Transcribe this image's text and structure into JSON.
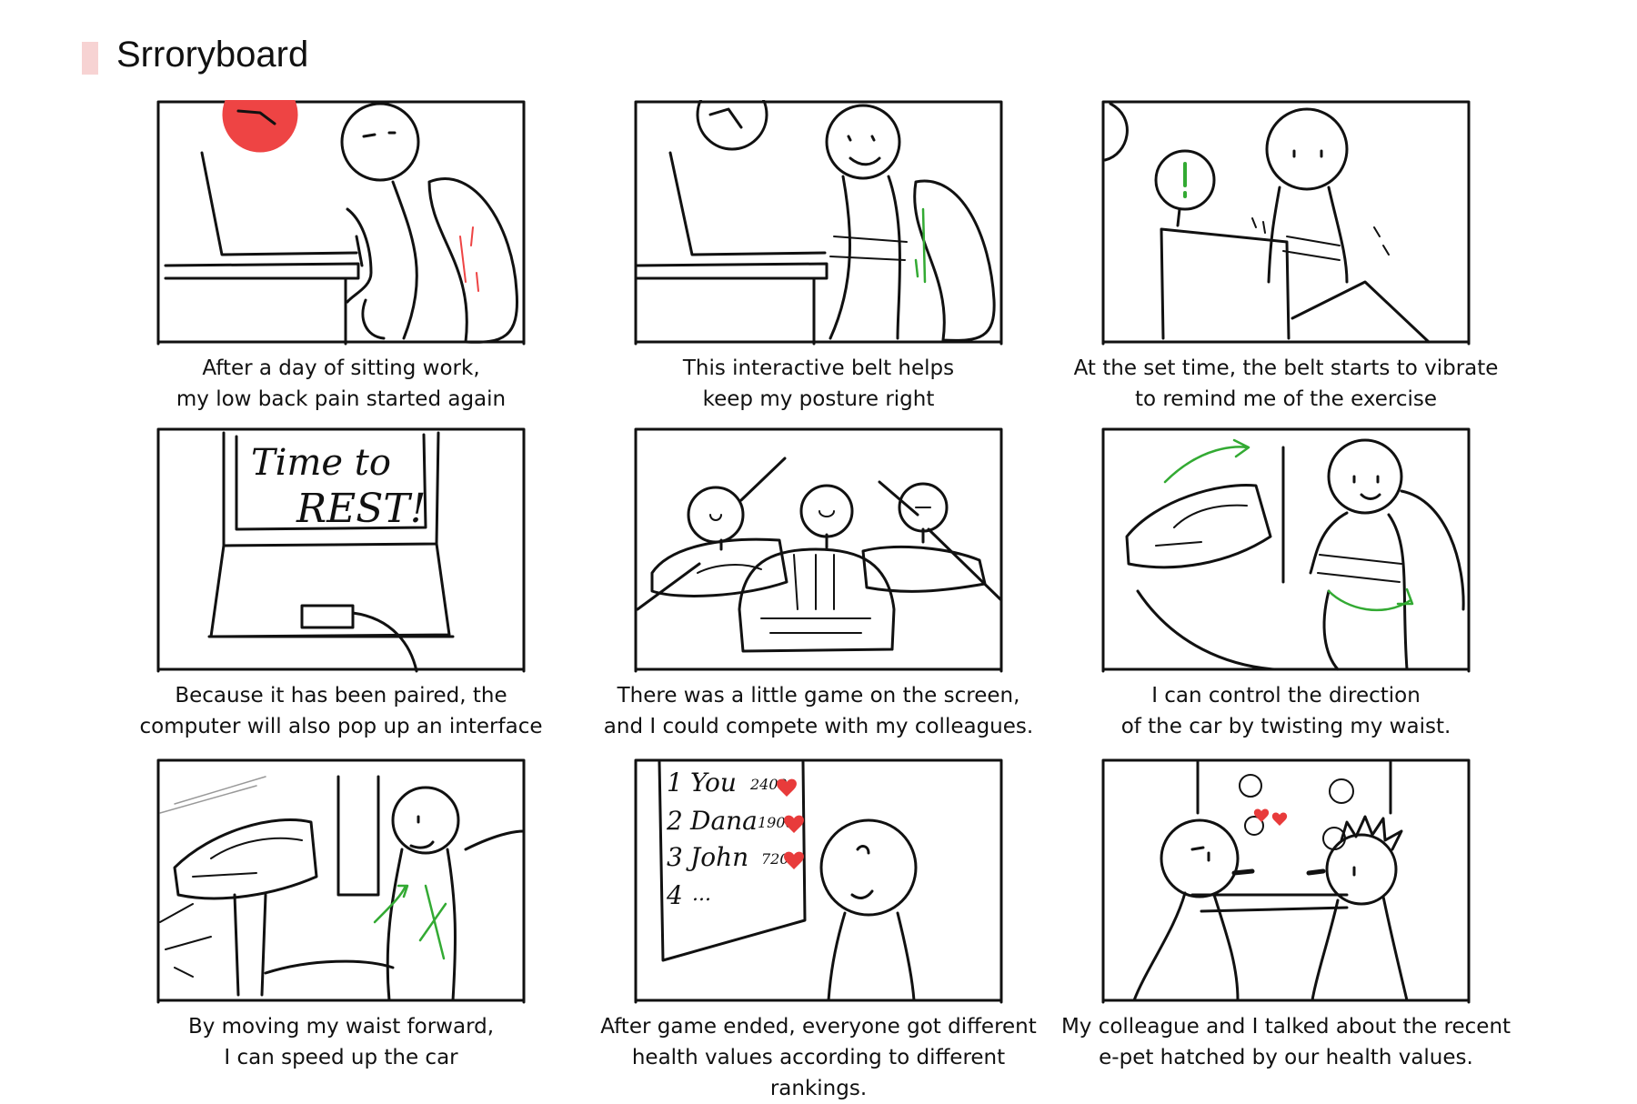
{
  "title": "Srroryboard",
  "colors": {
    "marker": "#f7d3d3",
    "ink": "#111111",
    "alarm_red": "#ee4444",
    "motion_green": "#33aa33",
    "heart_red": "#e83b3b"
  },
  "panels": [
    {
      "caption": [
        "After a day of sitting work,",
        "my low back pain started again"
      ]
    },
    {
      "caption": [
        "This interactive belt helps",
        "keep my posture right"
      ]
    },
    {
      "caption": [
        "At the set time, the belt starts to vibrate",
        "to remind me of the exercise"
      ]
    },
    {
      "caption": [
        "Because it has been paired, the",
        "computer will also pop up an interface"
      ],
      "screen_text": [
        "Time to",
        "REST!"
      ]
    },
    {
      "caption": [
        "There was a little game on the screen,",
        "and I could compete with my colleagues."
      ]
    },
    {
      "caption": [
        "I can control the direction",
        "of the car by twisting my waist."
      ]
    },
    {
      "caption": [
        "By moving my waist forward,",
        "I can speed up the car"
      ]
    },
    {
      "caption": [
        "After game ended, everyone got different",
        "health values according to different rankings."
      ],
      "leaderboard": [
        {
          "rank": "1",
          "name": "You",
          "score": "2400"
        },
        {
          "rank": "2",
          "name": "Dana",
          "score": "1900"
        },
        {
          "rank": "3",
          "name": "John",
          "score": "720"
        },
        {
          "rank": "4",
          "name": "...",
          "score": ""
        }
      ]
    },
    {
      "caption": [
        "My colleague and I talked about the recent",
        "e-pet hatched by our health values."
      ]
    }
  ]
}
